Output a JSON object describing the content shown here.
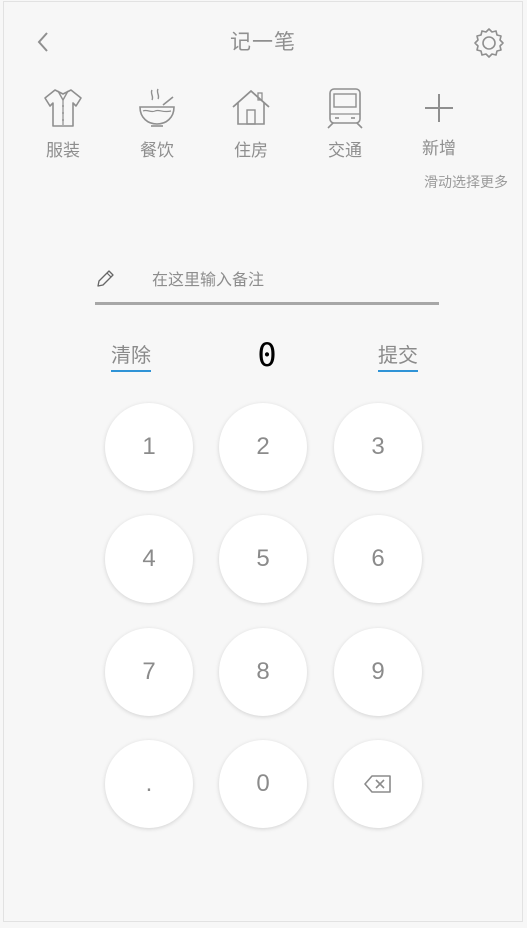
{
  "header": {
    "title": "记一笔",
    "back_icon": "chevron-left-icon",
    "settings_icon": "gear-icon"
  },
  "categories": [
    {
      "label": "服装",
      "icon": "shirt-icon"
    },
    {
      "label": "餐饮",
      "icon": "bowl-icon"
    },
    {
      "label": "住房",
      "icon": "house-icon"
    },
    {
      "label": "交通",
      "icon": "train-icon"
    },
    {
      "label": "新增",
      "icon": "plus-icon"
    }
  ],
  "hint": "滑动选择更多",
  "note": {
    "placeholder": "在这里输入备注",
    "value": ""
  },
  "actions": {
    "clear_label": "清除",
    "submit_label": "提交",
    "underline_color": "#2f93d6"
  },
  "amount": "0",
  "keypad": {
    "keys": [
      "1",
      "2",
      "3",
      "4",
      "5",
      "6",
      "7",
      "8",
      "9",
      ".",
      "0"
    ],
    "backspace_icon": "backspace-icon"
  }
}
